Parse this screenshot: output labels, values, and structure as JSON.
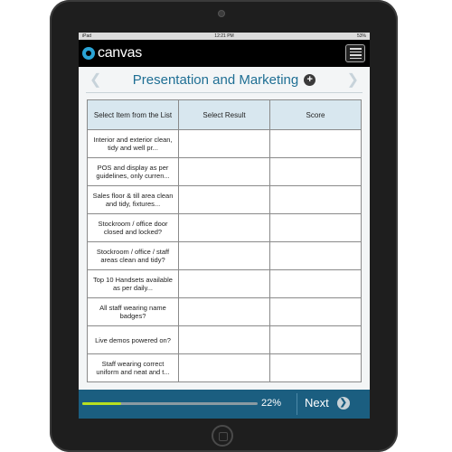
{
  "status_bar": {
    "carrier": "iPad",
    "time": "12:21 PM",
    "battery": "53%"
  },
  "app": {
    "name": "canvas"
  },
  "page": {
    "title": "Presentation and Marketing"
  },
  "table": {
    "headers": [
      "Select Item from the List",
      "Select Result",
      "Score"
    ],
    "rows": [
      "Interior and exterior clean, tidy and well pr...",
      "POS and display as per guidelines, only curren...",
      "Sales floor & till area clean and tidy, fixtures...",
      "Stockroom / office door closed and locked?",
      "Stockroom / office / staff areas clean and tidy?",
      "Top 10 Handsets available as per daily...",
      "All staff wearing name badges?",
      "Live demos powered on?",
      "Staff wearing correct uniform and neat and t..."
    ]
  },
  "footer": {
    "progress_fraction": 0.22,
    "progress_label": "22%",
    "next_label": "Next"
  },
  "icons": [
    "menu-icon",
    "chevron-left-icon",
    "chevron-right-icon",
    "add-circle-icon",
    "next-arrow-icon"
  ],
  "colors": {
    "title": "#1f6f94",
    "footer": "#1b5e80",
    "header_row": "#d8e7ef",
    "progress": "#b8e020"
  }
}
